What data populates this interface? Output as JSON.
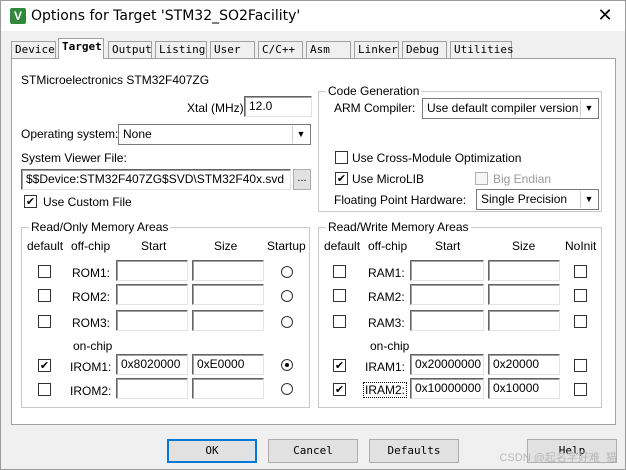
{
  "window": {
    "title": "Options for Target 'STM32_SO2Facility'",
    "close": "✕",
    "app_icon": "V"
  },
  "tabs": [
    {
      "label": "Device"
    },
    {
      "label": "Target"
    },
    {
      "label": "Output"
    },
    {
      "label": "Listing"
    },
    {
      "label": "User"
    },
    {
      "label": "C/C++"
    },
    {
      "label": "Asm"
    },
    {
      "label": "Linker"
    },
    {
      "label": "Debug"
    },
    {
      "label": "Utilities"
    }
  ],
  "target": {
    "device_name": "STMicroelectronics STM32F407ZG",
    "xtal_label": "Xtal (MHz):",
    "xtal_value": "12.0",
    "os_label": "Operating system:",
    "os_value": "None",
    "svf_label": "System Viewer File:",
    "svf_value": "$$Device:STM32F407ZG$SVD\\STM32F40x.svd",
    "browse_label": "...",
    "custom_file_label": "Use Custom File",
    "custom_file_checked": true
  },
  "codegen": {
    "title": "Code Generation",
    "compiler_label": "ARM Compiler:",
    "compiler_value": "Use default compiler version",
    "cross_module_label": "Use Cross-Module Optimization",
    "cross_module_checked": false,
    "microlib_label": "Use MicroLIB",
    "microlib_checked": true,
    "big_endian_label": "Big Endian",
    "big_endian_checked": false,
    "fph_label": "Floating Point Hardware:",
    "fph_value": "Single Precision"
  },
  "rom": {
    "title": "Read/Only Memory Areas",
    "headers": {
      "default": "default",
      "offchip": "off-chip",
      "start": "Start",
      "size": "Size",
      "startup": "Startup"
    },
    "onchip_label": "on-chip",
    "rows": [
      {
        "name": "ROM1:",
        "start": "",
        "size": "",
        "default": false,
        "startup": false
      },
      {
        "name": "ROM2:",
        "start": "",
        "size": "",
        "default": false,
        "startup": false
      },
      {
        "name": "ROM3:",
        "start": "",
        "size": "",
        "default": false,
        "startup": false
      },
      {
        "name": "IROM1:",
        "start": "0x8020000",
        "size": "0xE0000",
        "default": true,
        "startup": true
      },
      {
        "name": "IROM2:",
        "start": "",
        "size": "",
        "default": false,
        "startup": false
      }
    ]
  },
  "ram": {
    "title": "Read/Write Memory Areas",
    "headers": {
      "default": "default",
      "offchip": "off-chip",
      "start": "Start",
      "size": "Size",
      "noinit": "NoInit"
    },
    "onchip_label": "on-chip",
    "rows": [
      {
        "name": "RAM1:",
        "start": "",
        "size": "",
        "default": false,
        "noinit": false
      },
      {
        "name": "RAM2:",
        "start": "",
        "size": "",
        "default": false,
        "noinit": false
      },
      {
        "name": "RAM3:",
        "start": "",
        "size": "",
        "default": false,
        "noinit": false
      },
      {
        "name": "IRAM1:",
        "start": "0x20000000",
        "size": "0x20000",
        "default": true,
        "noinit": false
      },
      {
        "name": "IRAM2:",
        "start": "0x10000000",
        "size": "0x10000",
        "default": true,
        "noinit": false
      }
    ]
  },
  "buttons": {
    "ok": "OK",
    "cancel": "Cancel",
    "defaults": "Defaults",
    "help": "Help"
  },
  "watermark": "CSDN @起名字好难_猫"
}
